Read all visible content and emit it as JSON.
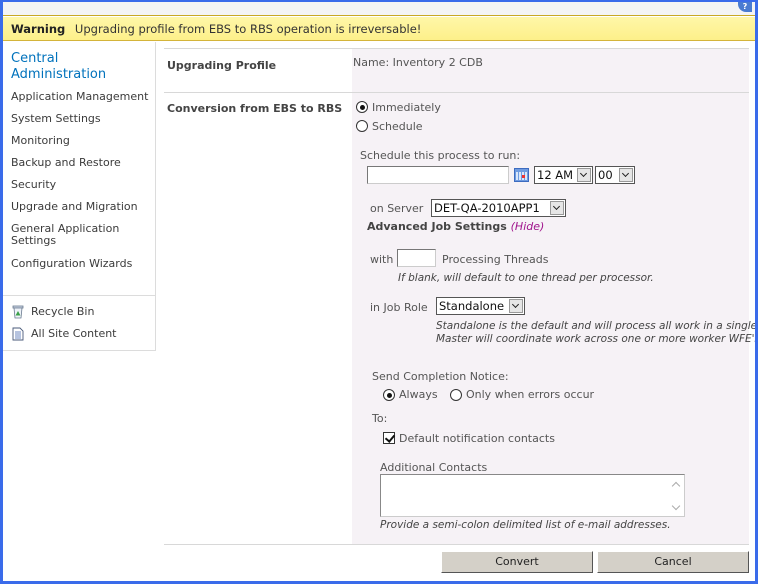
{
  "warning": {
    "label": "Warning",
    "message": "Upgrading profile from EBS to RBS operation is irreversable!"
  },
  "sidebar": {
    "title": "Central Administration",
    "title_line1": "Central",
    "title_line2": "Administration",
    "items": [
      {
        "label": "Application Management"
      },
      {
        "label": "System Settings"
      },
      {
        "label": "Monitoring"
      },
      {
        "label": "Backup and Restore"
      },
      {
        "label": "Security"
      },
      {
        "label": "Upgrade and Migration"
      },
      {
        "label": "General Application Settings",
        "line1": "General Application",
        "line2": "Settings"
      },
      {
        "label": "Configuration Wizards"
      }
    ],
    "links": [
      {
        "label": "Recycle Bin",
        "icon": "recycle-bin-icon"
      },
      {
        "label": "All Site Content",
        "icon": "document-icon"
      }
    ]
  },
  "form": {
    "profile": {
      "label": "Upgrading Profile",
      "name_text": "Name: Inventory 2 CDB"
    },
    "conversion": {
      "label": "Conversion from EBS to RBS",
      "options": [
        {
          "label": "Immediately",
          "selected": true
        },
        {
          "label": "Schedule",
          "selected": false
        }
      ],
      "schedule_label": "Schedule this process to run:",
      "date_value": "",
      "hour_value": "12 AM",
      "minute_value": "00",
      "server_label": "on Server",
      "server_value": "DET-QA-2010APP1",
      "advanced_label": "Advanced Job Settings",
      "hide_link": "(Hide)",
      "threads_prefix": "with",
      "threads_value": "",
      "threads_suffix": "Processing Threads",
      "threads_note": "If blank, will default to one thread per processor.",
      "job_role_label": "in Job Role",
      "job_role_value": "Standalone",
      "job_role_note_1": "Standalone is the default and will process all work in a single Job.",
      "job_role_note_2": "Master will coordinate work across one or more worker WFE's.",
      "notice_label": "Send Completion Notice:",
      "notice_options": [
        {
          "label": "Always",
          "selected": true
        },
        {
          "label": "Only when errors occur",
          "selected": false
        }
      ],
      "to_label": "To:",
      "default_contacts_label": "Default notification contacts",
      "default_contacts_checked": true,
      "additional_label": "Additional Contacts",
      "additional_value": "",
      "additional_note": "Provide a semi-colon delimited list of e-mail addresses."
    },
    "buttons": {
      "convert": "Convert",
      "cancel": "Cancel"
    }
  }
}
